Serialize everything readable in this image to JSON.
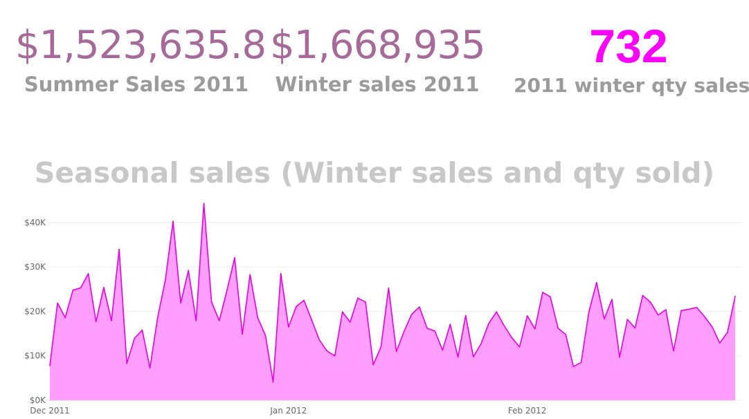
{
  "kpis": {
    "summer": {
      "value": "$1,523,635.8",
      "label": "Summer Sales 2011"
    },
    "winter": {
      "value": "$1,668,935",
      "label": "Winter sales 2011"
    },
    "qty": {
      "value": "732",
      "label": "2011 winter qty sales"
    }
  },
  "colors": {
    "kpi_value": "#a66999",
    "qty_value": "#ff00ff",
    "line": "#e600e6",
    "area": "#ff99ff",
    "label": "#9b9b9b",
    "title": "#c8c8c8"
  },
  "chart_data": {
    "type": "area",
    "title": "Seasonal sales (Winter sales and qty sold)",
    "xlabel": "",
    "ylabel": "",
    "ylim": [
      0,
      45000
    ],
    "y_ticks": [
      0,
      10000,
      20000,
      30000,
      40000
    ],
    "y_tick_labels": [
      "$0K",
      "$10K",
      "$20K",
      "$30K",
      "$40K"
    ],
    "x_ticks": [
      {
        "date": "2011-12-01",
        "label": "Dec 2011"
      },
      {
        "date": "2012-01-01",
        "label": "Jan 2012"
      },
      {
        "date": "2012-02-01",
        "label": "Feb 2012"
      }
    ],
    "grid": true,
    "series": [
      {
        "x_start": "2011-12-01",
        "x_step": "1 day",
        "values": [
          7800,
          21900,
          18600,
          24800,
          25300,
          28500,
          17700,
          25400,
          17900,
          34000,
          8300,
          14000,
          15800,
          7300,
          18600,
          27100,
          40300,
          21900,
          29200,
          17900,
          44300,
          22200,
          17900,
          24700,
          32100,
          14900,
          28300,
          18600,
          14600,
          4100,
          28500,
          16500,
          21100,
          22500,
          18100,
          13600,
          11100,
          10000,
          19900,
          17600,
          23000,
          22100,
          8000,
          12000,
          25300,
          11000,
          15500,
          19400,
          21000,
          16200,
          15600,
          11300,
          17100,
          9700,
          19100,
          9800,
          12700,
          17300,
          19900,
          16800,
          14100,
          12000,
          19000,
          16100,
          24300,
          23300,
          16200,
          14800,
          7600,
          8500,
          19900,
          26500,
          18300,
          22700,
          9700,
          18200,
          16300,
          23600,
          22100,
          19200,
          20400,
          11100,
          20200,
          20500,
          20900,
          18900,
          16600,
          12900,
          15300,
          23400
        ]
      }
    ]
  }
}
